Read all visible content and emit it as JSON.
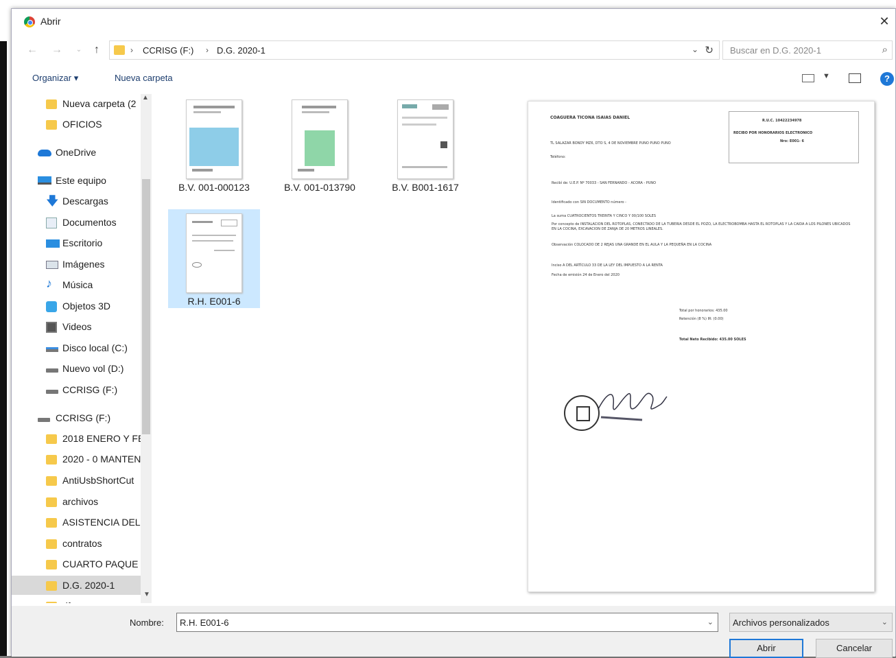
{
  "window": {
    "title": "Abrir",
    "close_glyph": "✕"
  },
  "nav": {
    "path": [
      "CCRISG (F:)",
      "D.G. 2020-1"
    ],
    "search_placeholder": "Buscar en D.G. 2020-1"
  },
  "toolbar": {
    "organize": "Organizar ▾",
    "new_folder": "Nueva carpeta"
  },
  "sidebar": {
    "items": [
      {
        "label": "Nueva carpeta (2",
        "icon": "folder-icon"
      },
      {
        "label": "OFICIOS",
        "icon": "folder-icon"
      },
      {
        "label": "OneDrive",
        "icon": "onedrive-icon"
      },
      {
        "label": "Este equipo",
        "icon": "computer-icon"
      },
      {
        "label": "Descargas",
        "icon": "download-icon"
      },
      {
        "label": "Documentos",
        "icon": "documents-icon"
      },
      {
        "label": "Escritorio",
        "icon": "desktop-icon"
      },
      {
        "label": "Imágenes",
        "icon": "pictures-icon"
      },
      {
        "label": "Música",
        "icon": "music-icon"
      },
      {
        "label": "Objetos 3D",
        "icon": "3d-objects-icon"
      },
      {
        "label": "Videos",
        "icon": "videos-icon"
      },
      {
        "label": "Disco local (C:)",
        "icon": "drive-icon"
      },
      {
        "label": "Nuevo vol (D:)",
        "icon": "drive-icon"
      },
      {
        "label": "CCRISG (F:)",
        "icon": "drive-icon"
      },
      {
        "label": "CCRISG (F:)",
        "icon": "drive-icon"
      },
      {
        "label": "2018 ENERO Y FE",
        "icon": "folder-icon"
      },
      {
        "label": "2020 - 0 MANTEN",
        "icon": "folder-icon"
      },
      {
        "label": "AntiUsbShortCut",
        "icon": "folder-icon"
      },
      {
        "label": "archivos",
        "icon": "folder-icon"
      },
      {
        "label": "ASISTENCIA DEL",
        "icon": "folder-icon"
      },
      {
        "label": "contratos",
        "icon": "folder-icon"
      },
      {
        "label": "CUARTO PAQUE",
        "icon": "folder-icon"
      },
      {
        "label": "D.G. 2020-1",
        "icon": "folder-icon"
      },
      {
        "label": "df",
        "icon": "folder-icon"
      }
    ]
  },
  "files": [
    {
      "name": "B.V. 001-000123"
    },
    {
      "name": "B.V. 001-013790"
    },
    {
      "name": "B.V. B001-1617"
    },
    {
      "name": "R.H. E001-6"
    }
  ],
  "preview": {
    "issuer": "COAGUERA TICONA ISAIAS DANIEL",
    "ruc": "R.U.C. 10422234978",
    "doc_title": "RECIBO POR HONORARIOS ELECTRONICO",
    "doc_number": "Nro: E001- 6",
    "address": "TL SALAZAR BONDY MZ6, DTO S, 4 DE NOVIEMBRE PUNO PUNO PUNO",
    "phone": "Teléfono:",
    "received_from": "Recibí de: U.E.P. Nº 70033 - SAN FERNANDO - ACORA - PUNO",
    "identified_with": "Identificado con SIN DOCUMENTO    número    -",
    "amount_words": "La suma   CUATROCIENTOS TREINTA Y CINCO Y 00/100 SOLES",
    "concept": "Por concepto de INSTALACION DEL ROTOPLAS, CONECTADO DE LA TUBERIA DESDE EL POZO, LA ELECTROBOMBA HASTA EL ROTOPLAS Y LA CAIDA A LOS PILONES UBICADOS EN LA COCINA, EXCAVACION DE ZANJA DE 20 METROS LINEALES.",
    "observation": "Observación   COLOCADO DE 2 REJAS UNA GRANDE EN EL AULA Y LA PEQUEÑA EN LA COCINA",
    "inciso": "Inciso  A   DEL ARTÍCULO 33 DE LA LEY DEL IMPUESTO A LA RENTA",
    "date": "Fecha de emisión   24   de   Enero   del  2020",
    "total_fees": "Total por honorarios:   435.00",
    "retention": "Retención (8 %) IR:   (0.00)",
    "net_total": "Total Neto Recibido:   435.00     SOLES"
  },
  "bottom": {
    "name_label": "Nombre:",
    "name_value": "R.H. E001-6",
    "filter": "Archivos personalizados",
    "open": "Abrir",
    "cancel": "Cancelar"
  }
}
